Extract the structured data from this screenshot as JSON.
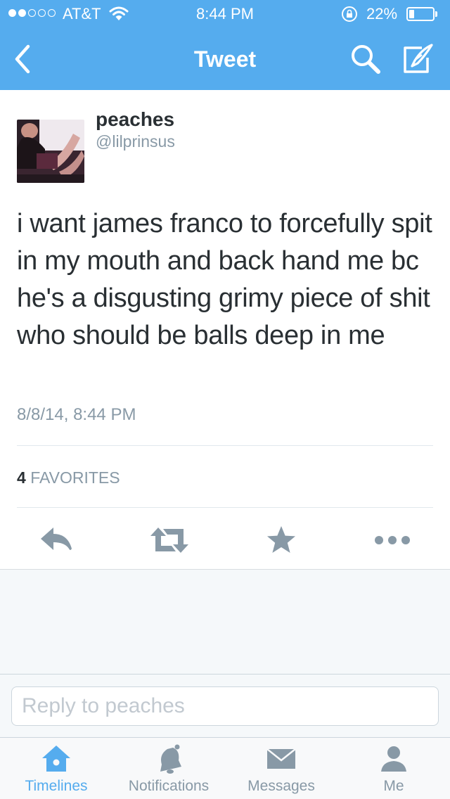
{
  "status_bar": {
    "carrier": "AT&T",
    "time": "8:44 PM",
    "battery": "22%",
    "battery_level": 0.22
  },
  "nav": {
    "title": "Tweet",
    "icons": [
      "back-chevron-icon",
      "search-icon",
      "compose-icon"
    ]
  },
  "tweet": {
    "name": "peaches",
    "handle": "@lilprinsus",
    "text": "i want james franco to forcefully spit in my mouth and back hand me bc he's a disgusting grimy piece of shit who should be balls deep in me",
    "timestamp": "8/8/14, 8:44 PM",
    "favorites_count": "4",
    "favorites_label": "FAVORITES",
    "actions": [
      "reply-icon",
      "retweet-icon",
      "favorite-star-icon",
      "more-icon"
    ]
  },
  "reply": {
    "placeholder": "Reply to peaches",
    "value": ""
  },
  "tabbar": {
    "tabs": [
      {
        "label": "Timelines",
        "icon": "home-icon",
        "active": true
      },
      {
        "label": "Notifications",
        "icon": "bell-icon",
        "active": false
      },
      {
        "label": "Messages",
        "icon": "envelope-icon",
        "active": false
      },
      {
        "label": "Me",
        "icon": "person-icon",
        "active": false
      }
    ]
  },
  "colors": {
    "brand": "#55acee",
    "text": "#292f33",
    "muted": "#8899a6",
    "divider": "#e1e8ed"
  }
}
